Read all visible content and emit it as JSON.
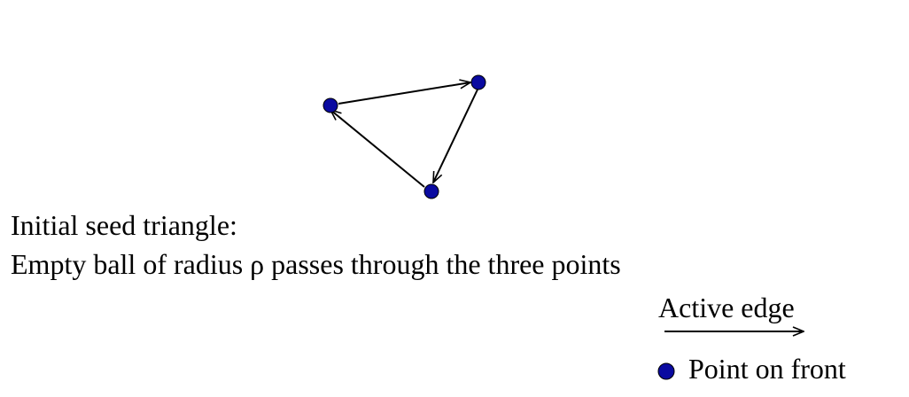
{
  "caption": {
    "line1": "Initial seed triangle:",
    "line2": "Empty ball of radius ρ passes through the three points"
  },
  "legend": {
    "active_edge_label": "Active edge",
    "point_label": "Point on front"
  },
  "colors": {
    "point_fill": "#0a0aa0",
    "point_stroke": "#000000",
    "edge": "#000000"
  }
}
